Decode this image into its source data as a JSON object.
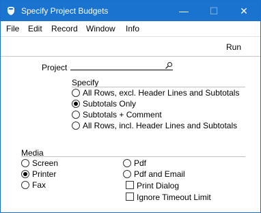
{
  "window": {
    "title": "Specify Project Budgets",
    "minimize_glyph": "—",
    "maximize_glyph": "☐",
    "close_glyph": "✕"
  },
  "menu": [
    "File",
    "Edit",
    "Record",
    "Window",
    "Info"
  ],
  "toolbar": {
    "run_label": "Run"
  },
  "form": {
    "project_label": "Project",
    "project_value": ""
  },
  "specify": {
    "label": "Specify",
    "options": [
      "All Rows, excl. Header Lines and Subtotals",
      "Subtotals Only",
      "Subtotals + Comment",
      "All Rows, incl. Header Lines and Subtotals"
    ],
    "selected": 1
  },
  "media": {
    "label": "Media",
    "left_options": [
      "Screen",
      "Printer",
      "Fax"
    ],
    "right_options": [
      "Pdf",
      "Pdf and Email"
    ],
    "selected": "Printer",
    "checkboxes": [
      {
        "label": "Print Dialog",
        "checked": false
      },
      {
        "label": "Ignore Timeout Limit",
        "checked": false
      }
    ]
  },
  "colors": {
    "titlebar": "#1b73d0",
    "window_border": "#1c6fc8"
  }
}
